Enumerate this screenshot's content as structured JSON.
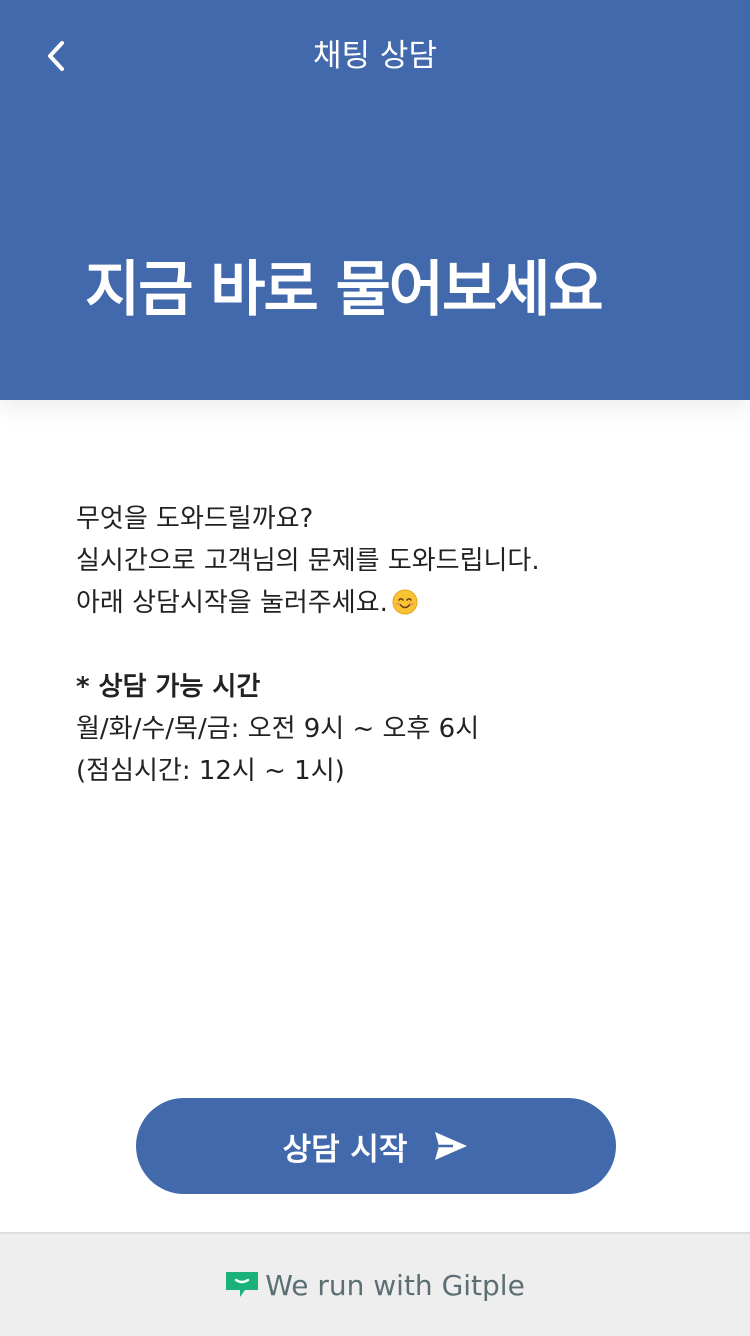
{
  "header": {
    "back_icon": "chevron-left-icon",
    "title": "채팅 상담",
    "hero_text": "지금 바로 물어보세요",
    "background_color": "#4169ab"
  },
  "content": {
    "intro_lines": [
      "무엇을 도와드릴까요?",
      "실시간으로 고객님의 문제를 도와드립니다.",
      "아래 상담시작을 눌러주세요."
    ],
    "intro_emoji_icon": "smiling-face-emoji",
    "hours_title": "* 상담 가능 시간",
    "hours_lines": [
      "월/화/수/목/금: 오전 9시 ~ 오후 6시",
      "(점심시간: 12시 ~ 1시)"
    ]
  },
  "start_button": {
    "label": "상담 시작",
    "icon": "send-icon",
    "color": "#4169ab"
  },
  "footer": {
    "brand_icon": "gitple-chat-icon",
    "text": "We run with Gitple",
    "brand_color": "#1ab27a"
  }
}
